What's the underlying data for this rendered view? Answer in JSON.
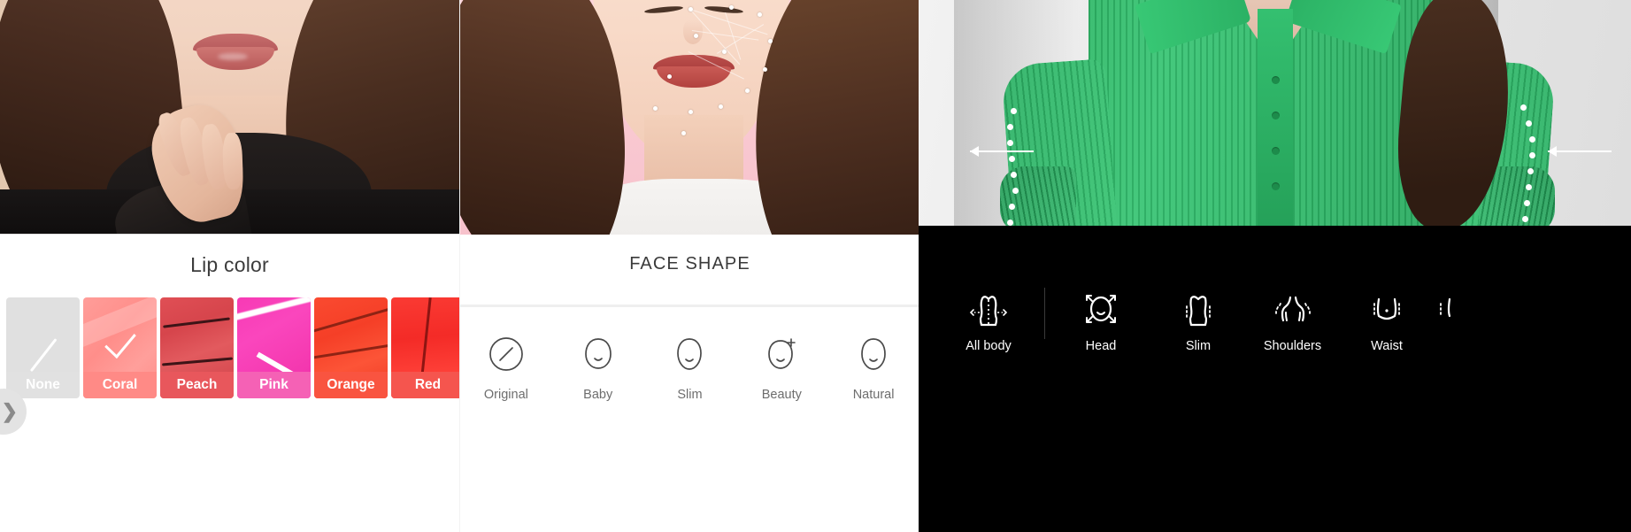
{
  "panels": {
    "lip": {
      "title": "Lip color",
      "swatches": [
        {
          "label": "None",
          "selected": false,
          "icon": "slash-icon",
          "color": "#e0e0e0"
        },
        {
          "label": "Coral",
          "selected": true,
          "icon": "check-icon",
          "color": "#ff8a86"
        },
        {
          "label": "Peach",
          "selected": false,
          "icon": "",
          "color": "#e8575c"
        },
        {
          "label": "Pink",
          "selected": false,
          "icon": "",
          "color": "#f561b5"
        },
        {
          "label": "Orange",
          "selected": false,
          "icon": "",
          "color": "#f95440"
        },
        {
          "label": "Red",
          "selected": false,
          "icon": "",
          "color": "#f5554e"
        }
      ],
      "expand_tab": {
        "icon": "chevron-right-icon",
        "glyph": "❯"
      }
    },
    "face": {
      "title": "FACE SHAPE",
      "items": [
        {
          "label": "Original",
          "icon": "face-none-icon",
          "selected": false
        },
        {
          "label": "Baby",
          "icon": "face-baby-icon",
          "selected": false
        },
        {
          "label": "Slim",
          "icon": "face-slim-icon",
          "selected": false
        },
        {
          "label": "Beauty",
          "icon": "face-beauty-icon",
          "selected": false
        },
        {
          "label": "Natural",
          "icon": "face-natural-icon",
          "selected": false
        }
      ]
    },
    "body": {
      "items": [
        {
          "label": "All body",
          "icon": "body-allbody-icon",
          "selected": false
        },
        {
          "label": "Head",
          "icon": "body-head-icon",
          "selected": false
        },
        {
          "label": "Slim",
          "icon": "body-slim-icon",
          "selected": false
        },
        {
          "label": "Shoulders",
          "icon": "body-shoulders-icon",
          "selected": false
        },
        {
          "label": "Waist",
          "icon": "body-waist-icon",
          "selected": false
        }
      ]
    }
  },
  "colors": {
    "accent": "#f5554e",
    "panel_dark": "#000000",
    "text_light": "#6d6d6d",
    "text_dark": "#3a3a3a",
    "garment_green": "#2eb867"
  }
}
